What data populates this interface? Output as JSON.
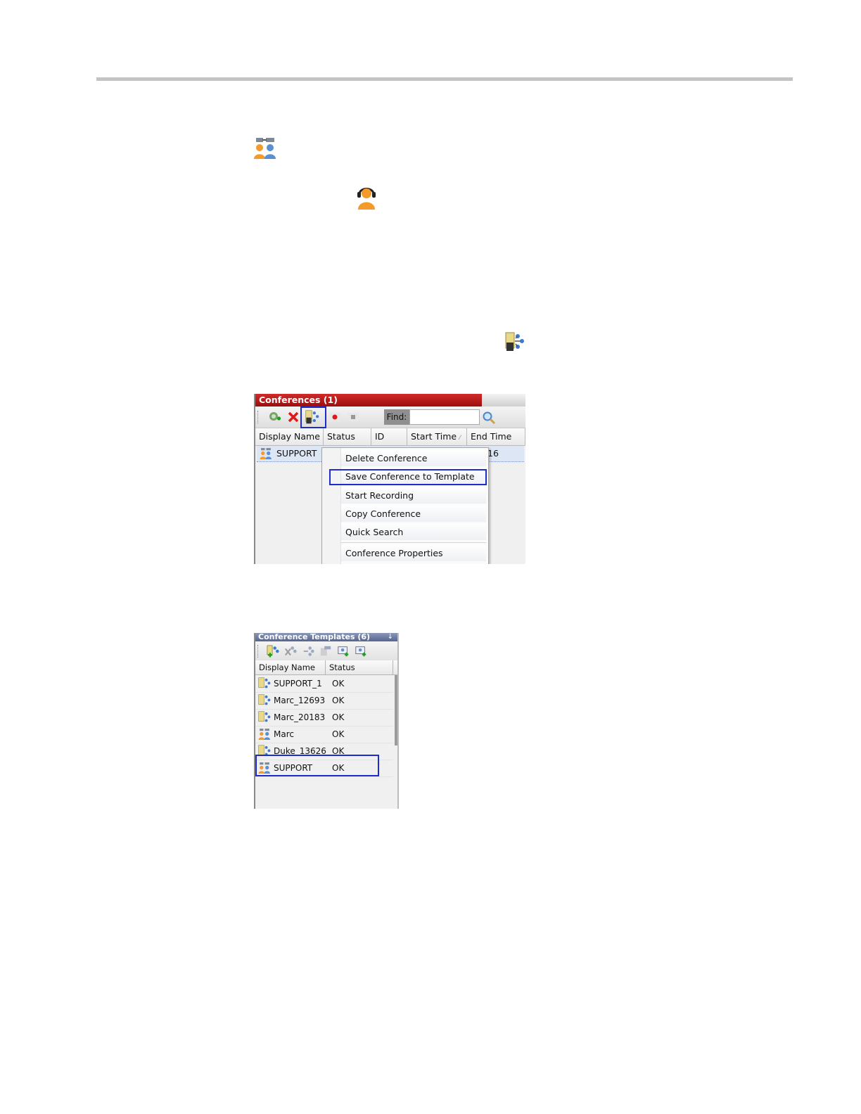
{
  "conferences_panel": {
    "title": "Conferences (1)",
    "find_label": "Find:",
    "columns": [
      "Display Name",
      "Status",
      "ID",
      "Start Time",
      "End Time"
    ],
    "sort_indicator": "⁄",
    "row": {
      "display_name": "SUPPORT",
      "end_time_partial": "16"
    },
    "context_menu": [
      "Delete Conference",
      "Save Conference to Template",
      "Start Recording",
      "Copy Conference",
      "Quick Search",
      "Conference Properties"
    ],
    "highlighted_menu_item": "Save Conference to Template",
    "toolbar_icons": [
      "new-conference-icon",
      "delete-icon",
      "save-to-template-icon",
      "record-icon",
      "stop-icon",
      "search-icon"
    ]
  },
  "templates_panel": {
    "title": "Conference Templates (6)",
    "pin": "↓",
    "columns": [
      "Display Name",
      "Status"
    ],
    "rows": [
      {
        "name": "SUPPORT_1",
        "status": "OK",
        "icon": "template-icon"
      },
      {
        "name": "Marc_12693",
        "status": "OK",
        "icon": "template-icon"
      },
      {
        "name": "Marc_20183",
        "status": "OK",
        "icon": "template-icon"
      },
      {
        "name": "Marc",
        "status": "OK",
        "icon": "conference-icon"
      },
      {
        "name": "Duke_13626",
        "status": "OK",
        "icon": "template-icon"
      },
      {
        "name": "SUPPORT",
        "status": "OK",
        "icon": "conference-icon"
      }
    ]
  },
  "colors": {
    "conf_title_bar": "#b51616",
    "templates_title_bar": "#6a78a0",
    "highlight_box": "#1d2bcf",
    "selected_row": "#dde6f4"
  }
}
